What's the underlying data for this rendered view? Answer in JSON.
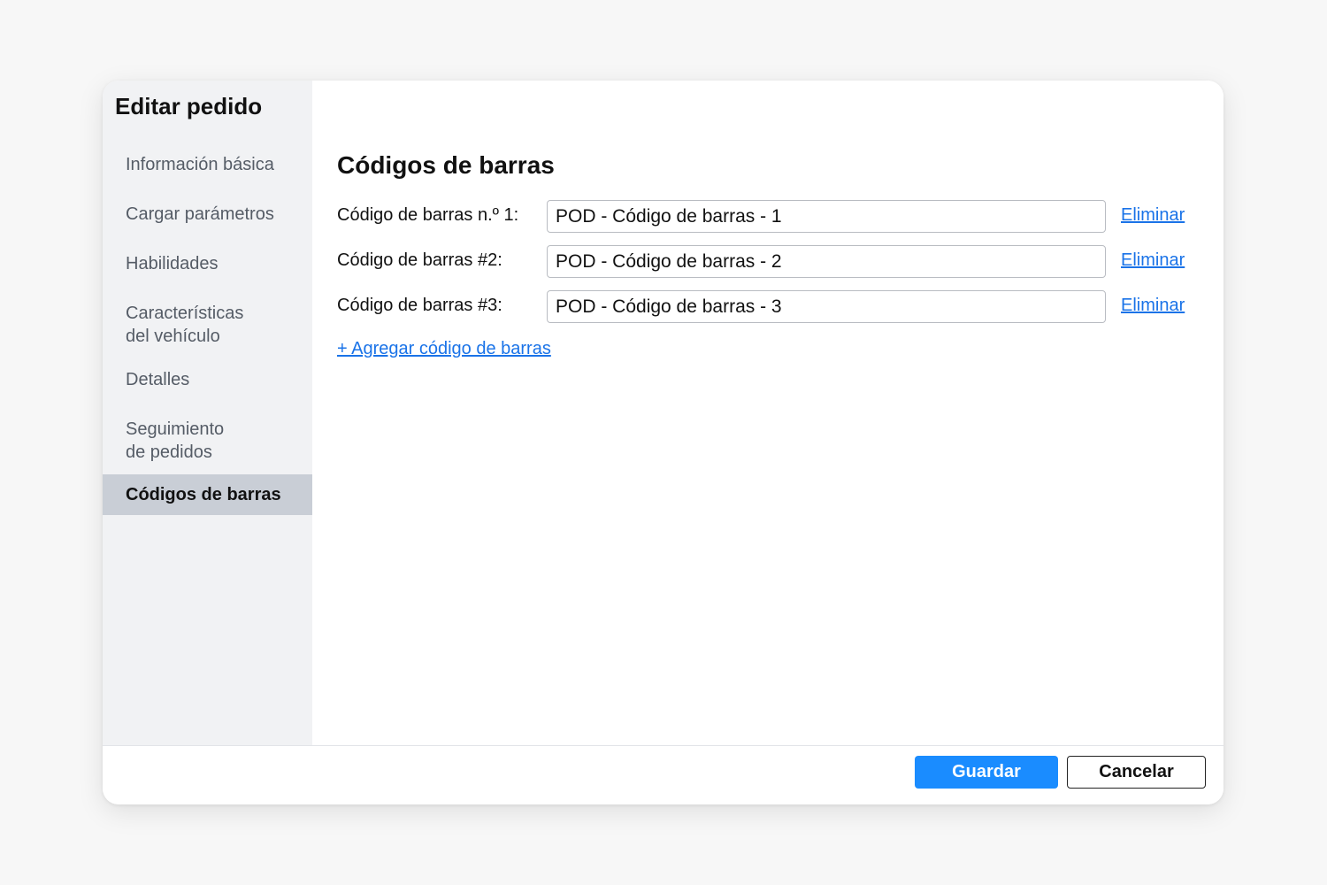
{
  "dialog": {
    "title": "Editar pedido"
  },
  "sidebar": {
    "items": [
      {
        "label": "Información básica"
      },
      {
        "label": "Cargar parámetros"
      },
      {
        "label": "Habilidades"
      },
      {
        "label_line1": "Características",
        "label_line2": "del vehículo"
      },
      {
        "label": "Detalles"
      },
      {
        "label_line1": "Seguimiento",
        "label_line2": "de pedidos"
      },
      {
        "label": "Códigos de barras",
        "active": true
      }
    ]
  },
  "main": {
    "section_title": "Códigos de barras",
    "barcodes": [
      {
        "label": "Código de barras n.º 1:",
        "value": "POD - Código de barras - 1",
        "remove_label": "Eliminar"
      },
      {
        "label": "Código de barras #2:",
        "value": "POD - Código de barras - 2",
        "remove_label": "Eliminar"
      },
      {
        "label": "Código de barras #3:",
        "value": "POD - Código de barras - 3",
        "remove_label": "Eliminar"
      }
    ],
    "add_label": "+ Agregar código de barras"
  },
  "footer": {
    "save_label": "Guardar",
    "cancel_label": "Cancelar"
  },
  "colors": {
    "accent": "#1a8cff",
    "link": "#1a73e8",
    "active_nav_bg": "#c9ced6"
  }
}
